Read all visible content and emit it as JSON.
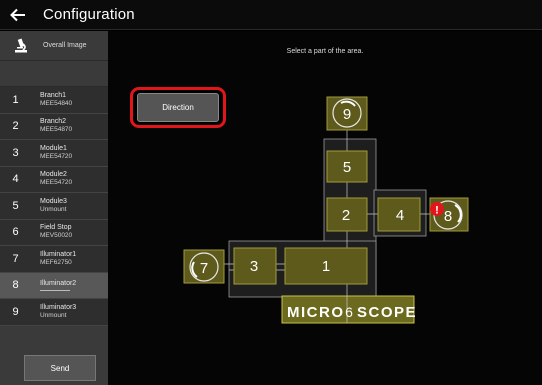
{
  "window": {
    "title": "Configuration"
  },
  "sidebar": {
    "overall_label": "Overall Image",
    "items": [
      {
        "num": "1",
        "line1": "Branch1",
        "line2": "MEE54840"
      },
      {
        "num": "2",
        "line1": "Branch2",
        "line2": "MEE54870"
      },
      {
        "num": "3",
        "line1": "Module1",
        "line2": "MEE54720"
      },
      {
        "num": "4",
        "line1": "Module2",
        "line2": "MEE54720"
      },
      {
        "num": "5",
        "line1": "Module3",
        "line2": "Unmount"
      },
      {
        "num": "6",
        "line1": "Field Stop",
        "line2": "MEV50020"
      },
      {
        "num": "7",
        "line1": "Illuminator1",
        "line2": "MEF62750"
      },
      {
        "num": "8",
        "line1": "Illuminator2",
        "line2": "",
        "selected": true
      },
      {
        "num": "9",
        "line1": "Illuminator3",
        "line2": "Unmount"
      }
    ],
    "send_label": "Send"
  },
  "main": {
    "hint": "Select a part of the area.",
    "direction_label": "Direction",
    "logo_left": "MICRO",
    "logo_num": "6",
    "logo_right": "SCOPE",
    "parts": [
      "1",
      "2",
      "3",
      "4",
      "5",
      "7",
      "8",
      "9"
    ],
    "alert": "!"
  },
  "colors": {
    "accent_red": "#e0161b",
    "part_fill": "#5e5a1c",
    "part_border": "#a09a3c",
    "logo_fill": "#6b6a1e"
  }
}
